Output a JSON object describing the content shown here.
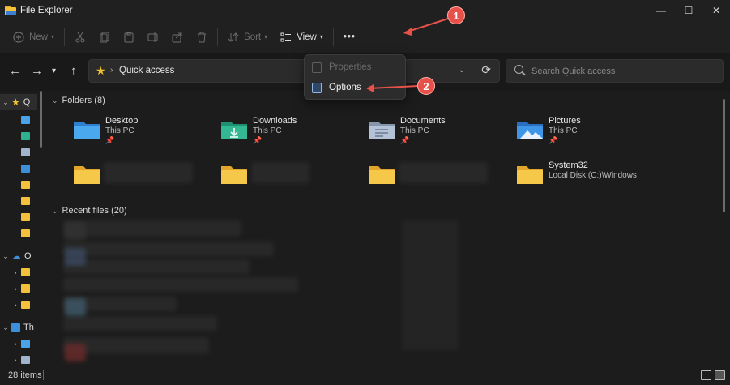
{
  "window": {
    "title": "File Explorer"
  },
  "commandbar": {
    "new_label": "New",
    "sort_label": "Sort",
    "view_label": "View",
    "more_label": "•••"
  },
  "address": {
    "location": "Quick access",
    "search_placeholder": "Search Quick access"
  },
  "menu": {
    "items": [
      {
        "label": "Properties",
        "enabled": false
      },
      {
        "label": "Options",
        "enabled": true
      }
    ]
  },
  "annotations": {
    "badge1": "1",
    "badge2": "2",
    "color": "#e7514a"
  },
  "sidebar": {
    "quick_access_label": "Q",
    "onedrive_label": "O",
    "thispc_label": "Th"
  },
  "folders_section": {
    "title": "Folders (8)"
  },
  "folders": [
    {
      "name": "Desktop",
      "location": "This PC",
      "pinned": true,
      "icon": "desktop-folder-icon"
    },
    {
      "name": "Downloads",
      "location": "This PC",
      "pinned": true,
      "icon": "downloads-folder-icon"
    },
    {
      "name": "Documents",
      "location": "This PC",
      "pinned": true,
      "icon": "documents-folder-icon"
    },
    {
      "name": "Pictures",
      "location": "This PC",
      "pinned": true,
      "icon": "pictures-folder-icon"
    },
    {
      "name": "System32",
      "location": "Local Disk (C:)\\Windows",
      "pinned": false,
      "icon": "folder-icon"
    }
  ],
  "recent_section": {
    "title": "Recent files (20)"
  },
  "status": {
    "items": "28 items"
  },
  "colors": {
    "background": "#1c1c1c",
    "accent": "#f3c13a",
    "annotation": "#e7514a"
  }
}
